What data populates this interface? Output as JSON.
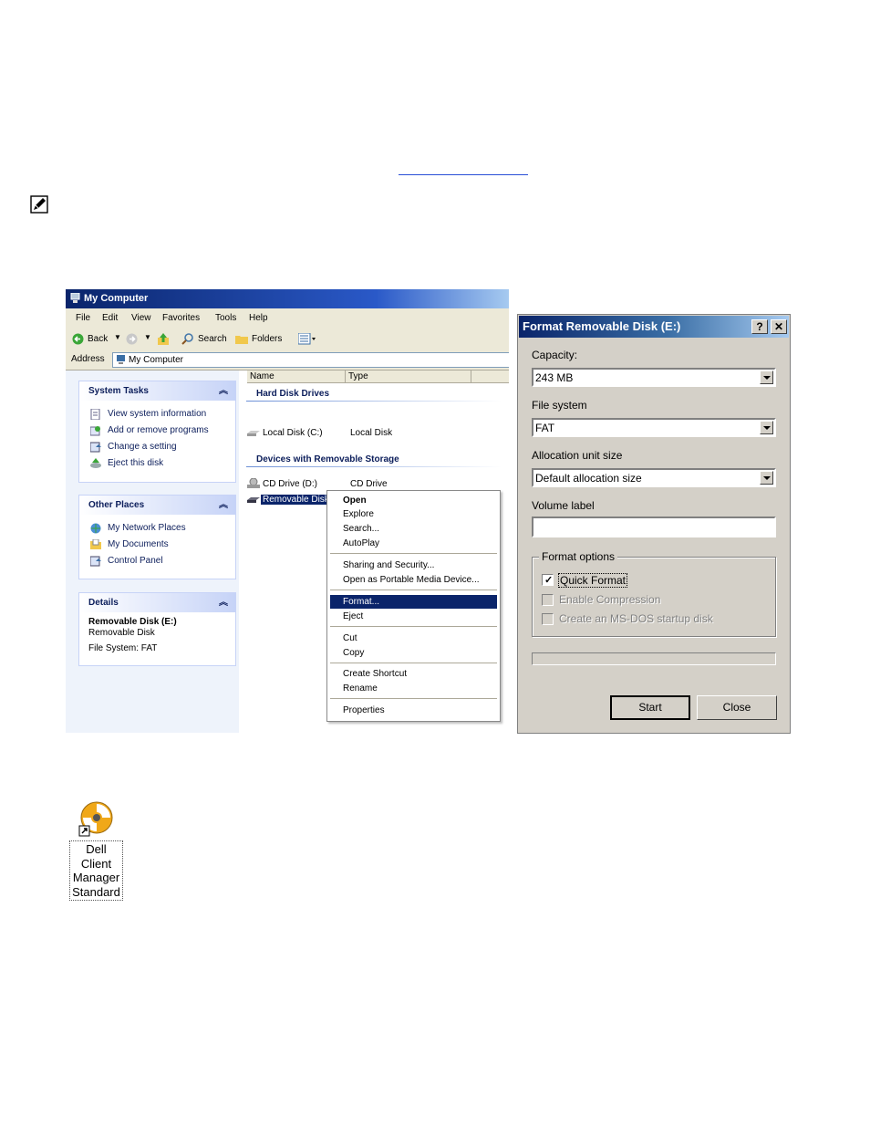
{
  "mycomputer": {
    "title": "My Computer",
    "menu": [
      "File",
      "Edit",
      "View",
      "Favorites",
      "Tools",
      "Help"
    ],
    "toolbar": {
      "back": "Back",
      "search": "Search",
      "folders": "Folders"
    },
    "address": {
      "label": "Address",
      "value": "My Computer"
    },
    "system_tasks": {
      "title": "System Tasks",
      "items": [
        "View system information",
        "Add or remove programs",
        "Change a setting",
        "Eject this disk"
      ]
    },
    "other_places": {
      "title": "Other Places",
      "items": [
        "My Network Places",
        "My Documents",
        "Control Panel"
      ]
    },
    "details": {
      "title": "Details",
      "name": "Removable Disk (E:)",
      "type": "Removable Disk",
      "fs": "File System: FAT"
    },
    "columns": [
      "Name",
      "Type"
    ],
    "groups": [
      "Hard Disk Drives",
      "Devices with Removable Storage"
    ],
    "rows": [
      {
        "name": "Local Disk (C:)",
        "type": "Local Disk"
      },
      {
        "name": "CD Drive (D:)",
        "type": "CD Drive"
      },
      {
        "name": "Removable Disk (E:)",
        "type": "Removable Disk"
      }
    ]
  },
  "context_menu": {
    "items": [
      "Open",
      "Explore",
      "Search...",
      "AutoPlay",
      "Sharing and Security...",
      "Open as Portable Media Device...",
      "Format...",
      "Eject",
      "Cut",
      "Copy",
      "Create Shortcut",
      "Rename",
      "Properties"
    ],
    "highlighted": "Format..."
  },
  "format_dialog": {
    "title": "Format Removable Disk (E:)",
    "help_btn": "?",
    "close_btn": "✕",
    "capacity_label": "Capacity:",
    "capacity_value": "243 MB",
    "fs_label": "File system",
    "fs_value": "FAT",
    "alloc_label": "Allocation unit size",
    "alloc_value": "Default allocation size",
    "volume_label": "Volume label",
    "volume_value": "",
    "options_legend": "Format options",
    "quick_format": "Quick Format",
    "quick_format_checked": true,
    "enable_compression": "Enable Compression",
    "msdos_startup": "Create an MS-DOS startup disk",
    "progress": 0,
    "start": "Start",
    "close": "Close"
  },
  "shortcut": {
    "label_lines": [
      "Dell Client",
      "Manager",
      "Standard"
    ]
  },
  "colors": {
    "xp_blue": "#0a246a",
    "dialog_gray": "#d4d0c8",
    "link": "#2a4fd6"
  },
  "icons": [
    "note-pencil-icon",
    "my-computer-icon",
    "dell-client-manager-icon"
  ]
}
